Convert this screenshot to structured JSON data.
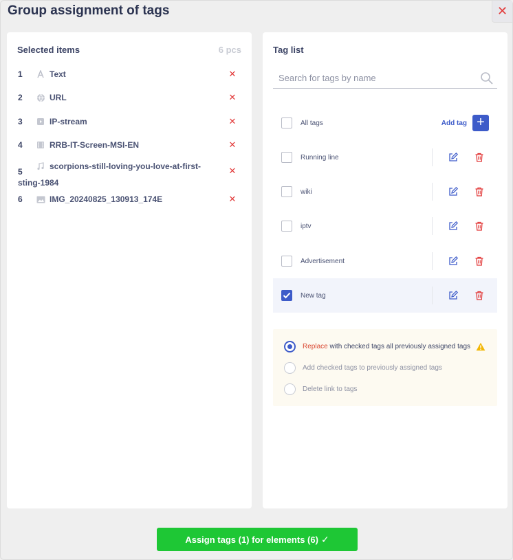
{
  "dialog": {
    "title": "Group assignment of tags",
    "close_glyph": "✕"
  },
  "selected": {
    "title": "Selected items",
    "count": "6 pcs",
    "items": [
      {
        "num": "1",
        "icon": "text-icon",
        "label": "Text"
      },
      {
        "num": "2",
        "icon": "globe-icon",
        "label": "URL"
      },
      {
        "num": "3",
        "icon": "stream-icon",
        "label": "IP-stream"
      },
      {
        "num": "4",
        "icon": "film-icon",
        "label": "RRB-IT-Screen-MSI-EN"
      },
      {
        "num": "5",
        "icon": "music-icon",
        "label": "scorpions-still-loving-you-love-at-first-",
        "label_line2": "sting-1984"
      },
      {
        "num": "6",
        "icon": "image-icon",
        "label": "IMG_20240825_130913_174E"
      }
    ],
    "remove_glyph": "✕"
  },
  "tags": {
    "title": "Tag list",
    "search_placeholder": "Search for tags by name",
    "all_tags_label": "All tags",
    "add_tag_label": "Add tag",
    "add_tag_glyph": "+",
    "list": [
      {
        "label": "Running line",
        "checked": false
      },
      {
        "label": "wiki",
        "checked": false
      },
      {
        "label": "iptv",
        "checked": false
      },
      {
        "label": "Advertisement",
        "checked": false
      },
      {
        "label": "New tag",
        "checked": true
      }
    ]
  },
  "options": {
    "replace_accent": "Replace",
    "replace_rest": " with checked tags all previously assigned tags",
    "add": "Add checked tags to previously assigned tags",
    "delete": "Delete link to tags",
    "selected": "replace"
  },
  "footer": {
    "assign_label": "Assign tags (1) for elements (6)",
    "assign_check": "✓"
  },
  "colors": {
    "accent": "#3d5bc9",
    "danger": "#e23b3b",
    "success": "#1ec735",
    "warning": "#f2b705"
  }
}
